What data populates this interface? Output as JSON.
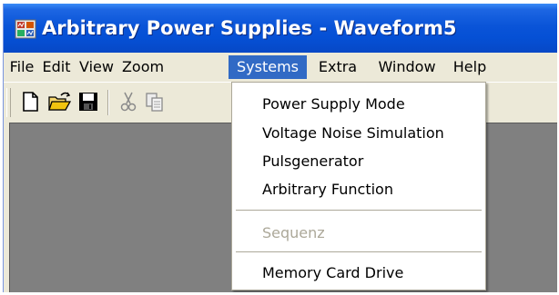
{
  "window": {
    "title": "Arbitrary Power Supplies - Waveform5",
    "app_icon": "app-icon"
  },
  "menubar": {
    "items": [
      {
        "label": "File"
      },
      {
        "label": "Edit"
      },
      {
        "label": "View"
      },
      {
        "label": "Zoom"
      },
      {
        "label": "Systems",
        "active": true
      },
      {
        "label": "Extra"
      },
      {
        "label": "Window"
      },
      {
        "label": "Help"
      }
    ]
  },
  "toolbar": {
    "buttons": [
      {
        "icon": "new-document-icon"
      },
      {
        "icon": "open-folder-icon"
      },
      {
        "icon": "save-disk-icon"
      },
      {
        "icon": "cut-icon",
        "enabled": false
      },
      {
        "icon": "copy-icon",
        "enabled": false
      }
    ]
  },
  "systems_menu": {
    "items": [
      {
        "label": "Power Supply Mode",
        "enabled": true
      },
      {
        "label": "Voltage Noise Simulation",
        "enabled": true
      },
      {
        "label": "Pulsgenerator",
        "enabled": true
      },
      {
        "label": "Arbitrary Function",
        "enabled": true
      },
      {
        "label": "Sequenz",
        "enabled": false
      },
      {
        "label": "Memory Card Drive",
        "enabled": true
      }
    ]
  },
  "colors": {
    "titlebar": "#0550d5",
    "menu_highlight": "#316ac5",
    "workspace": "#808080",
    "disabled_text": "#aca899"
  }
}
